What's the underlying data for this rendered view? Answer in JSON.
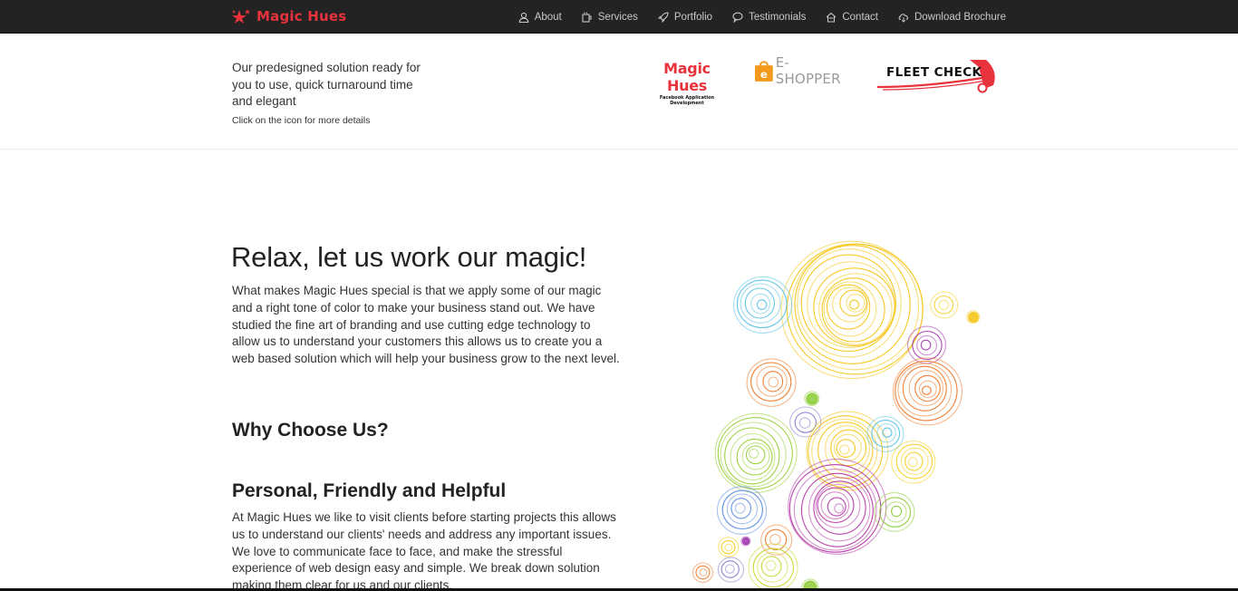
{
  "header": {
    "brand": "Magic Hues",
    "nav": [
      {
        "label": "About",
        "icon": "user-icon"
      },
      {
        "label": "Services",
        "icon": "coffee-icon"
      },
      {
        "label": "Portfolio",
        "icon": "rocket-icon"
      },
      {
        "label": "Testimonials",
        "icon": "chat-icon"
      },
      {
        "label": "Contact",
        "icon": "home-icon"
      },
      {
        "label": "Download Brochure",
        "icon": "cloud-download-icon"
      }
    ]
  },
  "solutions": {
    "lead": "Our predesigned solution ready for you to use, quick turnaround time and elegant",
    "hint": "Click on the icon for more details",
    "logos": {
      "magic_hues": {
        "title": "Magic Hues",
        "subtitle": "Facebook Application Development"
      },
      "eshopper": {
        "title": "E-SHOPPER",
        "bag_letter": "e"
      },
      "fleetcheck": {
        "title": "FLEET CHECK"
      }
    }
  },
  "main": {
    "title": "Relax, let us work our magic!",
    "body": "What makes Magic Hues special is that we apply some of our magic and a right tone of color to make your business stand out. We have studied the fine art of branding and use cutting edge technology to allow us to understand your customers this allows us to create you a web based solution which will help your business grow to the next level.",
    "why_heading": "Why Choose Us?",
    "section_heading": "Personal, Friendly and Helpful",
    "section_body": "At Magic Hues we like to visit clients before starting projects this allows us to understand our clients' needs and address any important issues. We love to communicate face to face, and make the stressful experience of web design easy and simple. We break down solution making them clear for us and our clients."
  },
  "colors": {
    "topbar": "#232323",
    "brand_red": "#e8323c",
    "nav_text": "#c9c9c9",
    "eshopper_orange": "#f39a1c"
  }
}
